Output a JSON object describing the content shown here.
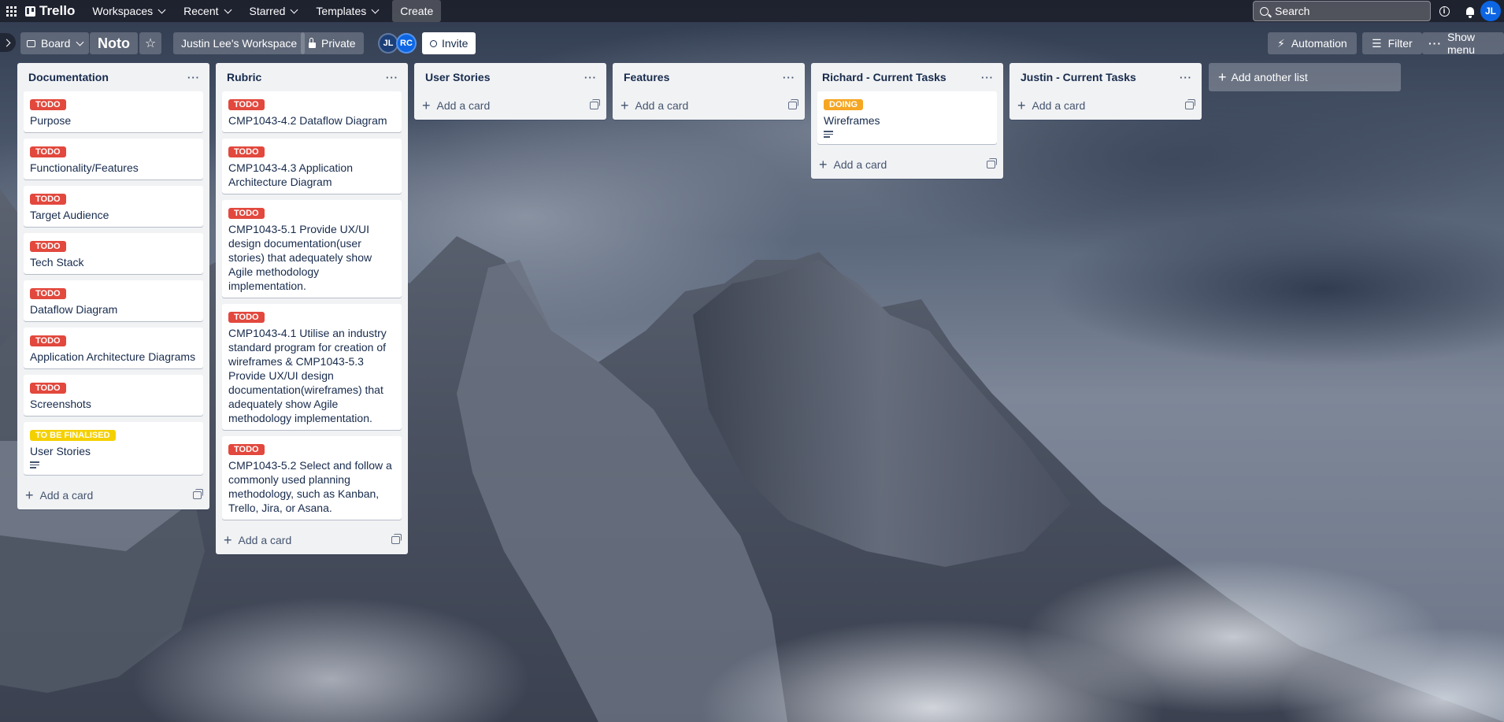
{
  "topnav": {
    "logo": "Trello",
    "menus": [
      "Workspaces",
      "Recent",
      "Starred",
      "Templates"
    ],
    "create_label": "Create",
    "search_placeholder": "Search",
    "user_initials": "JL"
  },
  "board": {
    "view_label": "Board",
    "name": "Noto",
    "workspace": "Justin Lee's Workspace",
    "visibility": "Private",
    "members": [
      "JL",
      "RC"
    ],
    "invite_label": "Invite",
    "automation_label": "Automation",
    "filter_label": "Filter",
    "menu_label": "Show menu"
  },
  "lists": [
    {
      "title": "Documentation",
      "cards": [
        {
          "label": "TODO",
          "label_color": "#e2483d",
          "title": "Purpose"
        },
        {
          "label": "TODO",
          "label_color": "#e2483d",
          "title": "Functionality/Features"
        },
        {
          "label": "TODO",
          "label_color": "#e2483d",
          "title": "Target Audience"
        },
        {
          "label": "TODO",
          "label_color": "#e2483d",
          "title": "Tech Stack"
        },
        {
          "label": "TODO",
          "label_color": "#e2483d",
          "title": "Dataflow Diagram"
        },
        {
          "label": "TODO",
          "label_color": "#e2483d",
          "title": "Application Architecture Diagrams"
        },
        {
          "label": "TODO",
          "label_color": "#e2483d",
          "title": "Screenshots"
        },
        {
          "label": "TO BE FINALISED",
          "label_color": "#f5d000",
          "title": "User Stories",
          "has_description": true
        }
      ]
    },
    {
      "title": "Rubric",
      "cards": [
        {
          "label": "TODO",
          "label_color": "#e2483d",
          "title": "CMP1043-4.2 Dataflow Diagram"
        },
        {
          "label": "TODO",
          "label_color": "#e2483d",
          "title": "CMP1043-4.3 Application Architecture Diagram"
        },
        {
          "label": "TODO",
          "label_color": "#e2483d",
          "title": "CMP1043-5.1 Provide UX/UI design documentation(user stories) that adequately show Agile methodology implementation."
        },
        {
          "label": "TODO",
          "label_color": "#e2483d",
          "title": "CMP1043-4.1 Utilise an industry standard program for creation of wireframes & CMP1043-5.3 Provide UX/UI design documentation(wireframes) that adequately show Agile methodology implementation."
        },
        {
          "label": "TODO",
          "label_color": "#e2483d",
          "title": "CMP1043-5.2 Select and follow a commonly used planning methodology, such as Kanban, Trello, Jira, or Asana."
        }
      ]
    },
    {
      "title": "User Stories",
      "cards": []
    },
    {
      "title": "Features",
      "cards": []
    },
    {
      "title": "Richard - Current Tasks",
      "cards": [
        {
          "label": "DOING",
          "label_color": "#f5a623",
          "title": "Wireframes",
          "has_description": true
        }
      ]
    },
    {
      "title": "Justin - Current Tasks",
      "cards": []
    }
  ],
  "add_card_label": "Add a card",
  "add_list_label": "Add another list"
}
